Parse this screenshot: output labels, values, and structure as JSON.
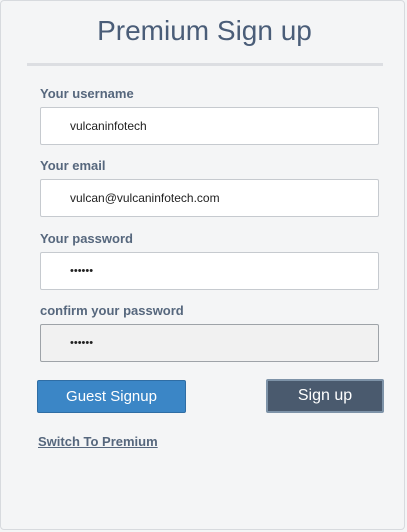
{
  "page": {
    "title": "Premium Sign up"
  },
  "form": {
    "username": {
      "label": "Your username",
      "value": "vulcaninfotech"
    },
    "email": {
      "label": "Your email",
      "value": "vulcan@vulcaninfotech.com"
    },
    "password": {
      "label": "Your password",
      "value": "••••••"
    },
    "confirm_password": {
      "label": "confirm your password",
      "value": "••••••"
    }
  },
  "actions": {
    "guest_signup_label": "Guest Signup",
    "signup_label": "Sign up",
    "switch_link_label": "Switch To Premium"
  },
  "colors": {
    "title": "#4a5d78",
    "guest_button": "#3b86c6",
    "signup_button": "#4a5a6e",
    "label": "#56677d"
  }
}
